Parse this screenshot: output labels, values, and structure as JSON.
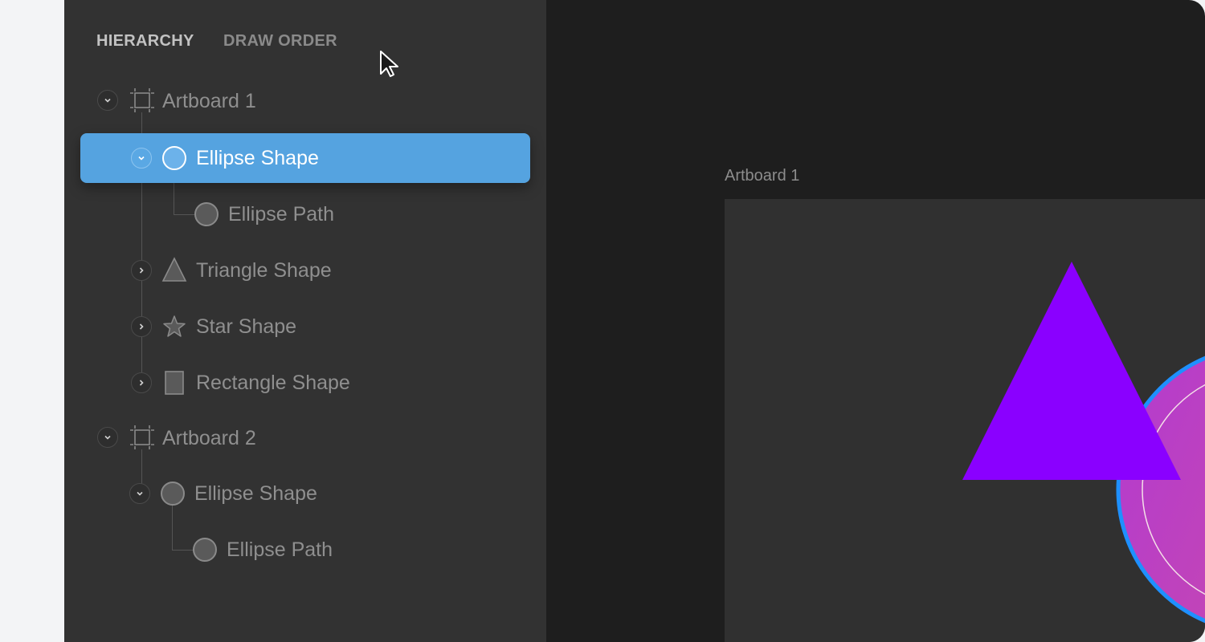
{
  "tabs": {
    "hierarchy": "HIERARCHY",
    "draw_order": "DRAW ORDER"
  },
  "tree": {
    "artboard1": "Artboard 1",
    "ellipse_shape_1": "Ellipse Shape",
    "ellipse_path_1": "Ellipse Path",
    "triangle_shape": "Triangle Shape",
    "star_shape": "Star Shape",
    "rectangle_shape": "Rectangle Shape",
    "artboard2": "Artboard 2",
    "ellipse_shape_2": "Ellipse Shape",
    "ellipse_path_2": "Ellipse Path"
  },
  "canvas": {
    "artboard_caption": "Artboard 1"
  },
  "colors": {
    "selection": "#55a3e0",
    "triangle": "#8a00ff",
    "circle_fill": "#c03cc8",
    "circle_stroke": "#1e90ff"
  }
}
